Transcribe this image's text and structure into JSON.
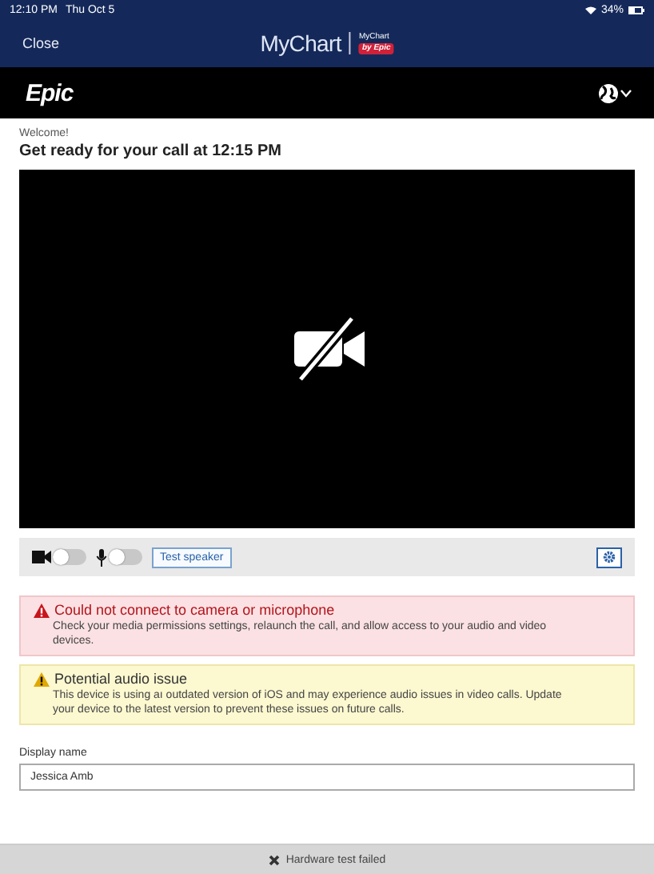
{
  "status_bar": {
    "time": "12:10 PM",
    "date": "Thu Oct 5",
    "battery": "34%"
  },
  "header": {
    "close": "Close",
    "logo": "MyChart",
    "badge_top": "MyChart",
    "badge_bottom": "by Epic"
  },
  "brand_bar": {
    "logo": "Epic"
  },
  "welcome": "Welcome!",
  "title": "Get ready for your call at 12:15 PM",
  "video": {
    "camera_on": false
  },
  "controls": {
    "camera_toggle": {
      "on": false
    },
    "mic_toggle": {
      "on": false
    },
    "test_button": "Test speaker"
  },
  "alerts": [
    {
      "kind": "error",
      "title": "Could not connect to camera or microphone",
      "body": "Check your media permissions settings, relaunch the call, and allow access to your audio and video devices."
    },
    {
      "kind": "warning",
      "title": "Potential audio issue",
      "body": "This device is using aı outdated version of iOS and may experience audio issues in video calls. Update your device to the latest version to prevent these issues on future calls."
    }
  ],
  "display_name": {
    "label": "Display name",
    "value": "Jessica Amb"
  },
  "footer": {
    "message": "Hardware test failed"
  }
}
